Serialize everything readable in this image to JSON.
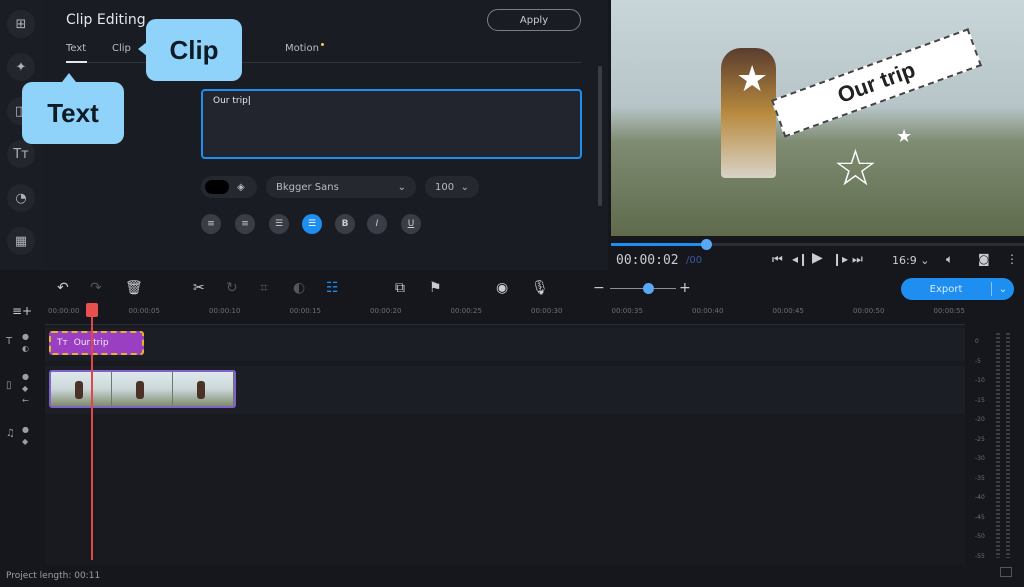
{
  "panel": {
    "title": "Clip Editing",
    "apply_label": "Apply",
    "tabs": [
      {
        "label": "Text"
      },
      {
        "label": "Clip"
      },
      {
        "label": "Motion"
      }
    ],
    "text_value": "Our trip",
    "font_name": "Bkgger Sans",
    "font_size": "100"
  },
  "callouts": {
    "clip": "Clip",
    "text": "Text"
  },
  "sidebar": {
    "items": [
      {
        "icon": "import-icon"
      },
      {
        "icon": "magic-wand-icon"
      },
      {
        "icon": "transitions-icon"
      },
      {
        "icon": "titles-icon"
      },
      {
        "icon": "stickers-icon"
      },
      {
        "icon": "more-tools-icon"
      }
    ]
  },
  "preview": {
    "overlay_text": "Our trip",
    "current_time": "00:00:02",
    "total_time": "/00",
    "aspect": "16:9",
    "progress": 0.23
  },
  "timeline": {
    "export_label": "Export",
    "ruler": [
      "00:00:00",
      "00:00:05",
      "00:00:10",
      "00:00:15",
      "00:00:20",
      "00:00:25",
      "00:00:30",
      "00:00:35",
      "00:00:40",
      "00:00:45",
      "00:00:50",
      "00:00:55"
    ],
    "title_clip": "Our trip",
    "meter_labels": [
      "0",
      "-5",
      "-10",
      "-15",
      "-20",
      "-25",
      "-30",
      "-35",
      "-40",
      "-45",
      "-50",
      "-55"
    ]
  },
  "status": {
    "project_length": "Project length: 00:11"
  },
  "colors": {
    "accent": "#1e8ef0",
    "title_clip": "#9b3fc2",
    "callout": "#8fd3fb",
    "playhead": "#e04848"
  }
}
